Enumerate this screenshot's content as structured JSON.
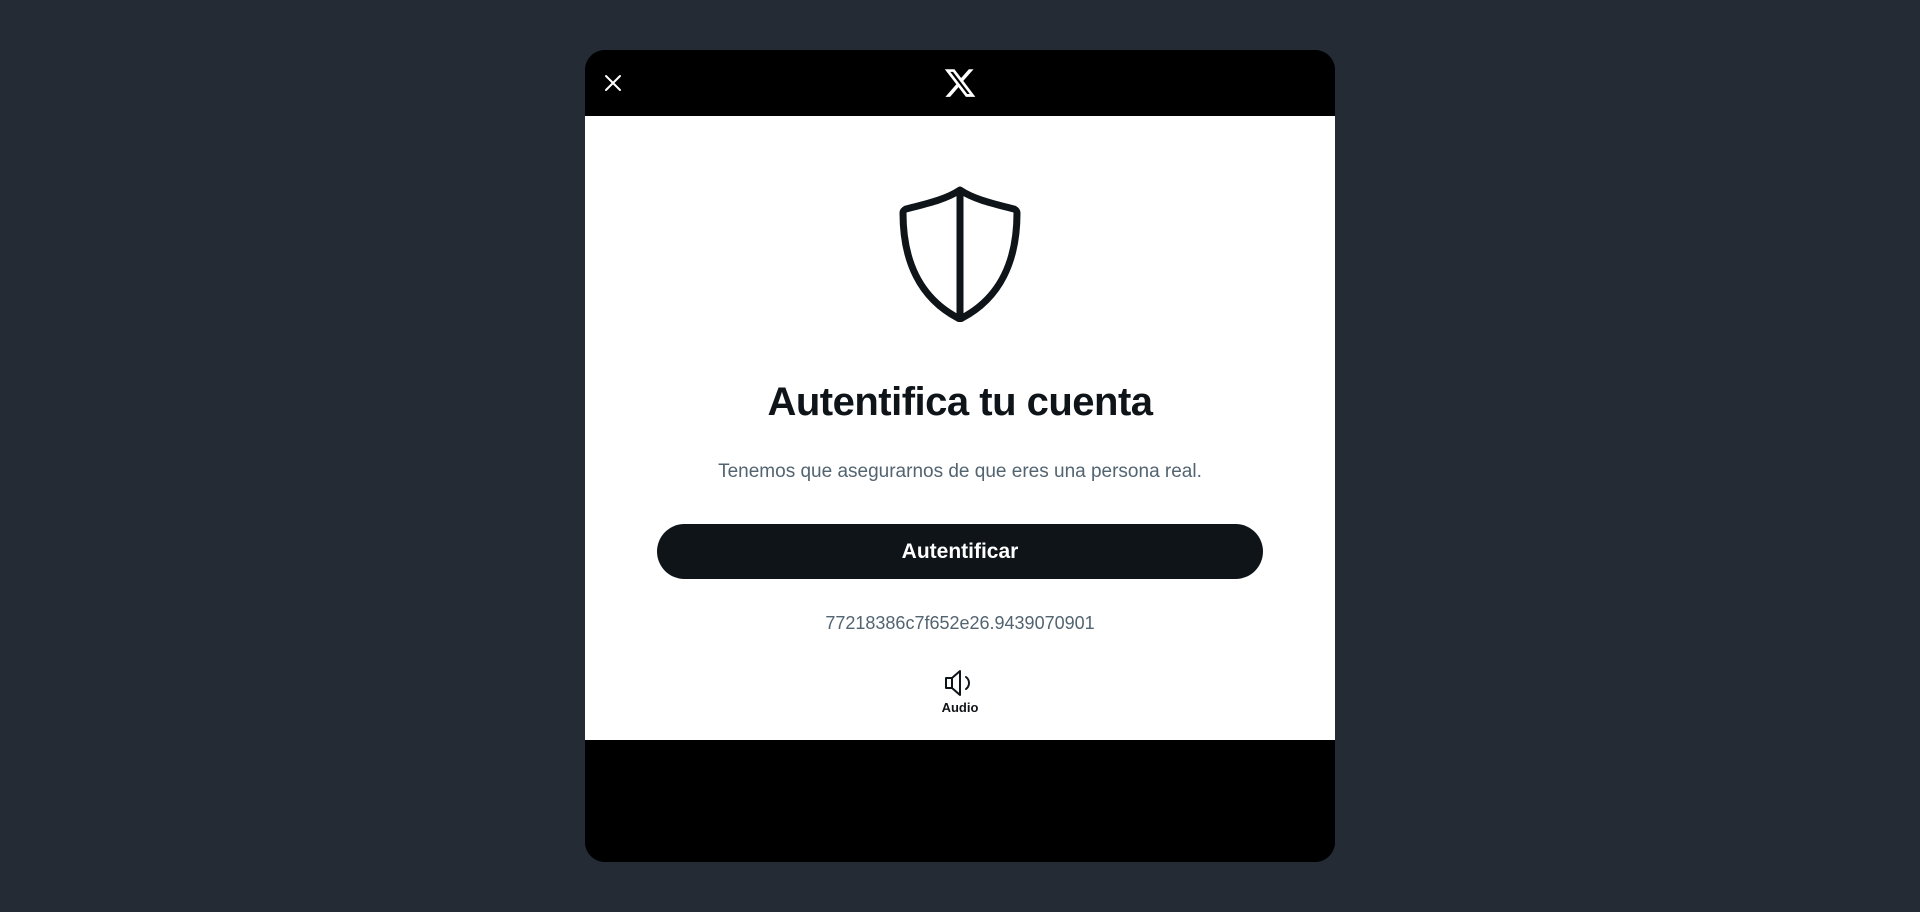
{
  "dialog": {
    "close_icon": "close-icon",
    "logo_icon": "x-logo-icon"
  },
  "content": {
    "shield_icon": "shield-icon",
    "title": "Autentifica tu cuenta",
    "subtitle": "Tenemos que asegurarnos de que eres una persona real.",
    "button_label": "Autentificar",
    "session_id": "77218386c7f652e26.9439070901",
    "audio_icon": "speaker-icon",
    "audio_label": "Audio"
  },
  "colors": {
    "page_background": "#242b35",
    "modal_background": "#000000",
    "panel_background": "#ffffff",
    "button_background": "#0f1419",
    "button_text": "#ffffff",
    "title_text": "#0f1419",
    "muted_text": "#536471"
  }
}
